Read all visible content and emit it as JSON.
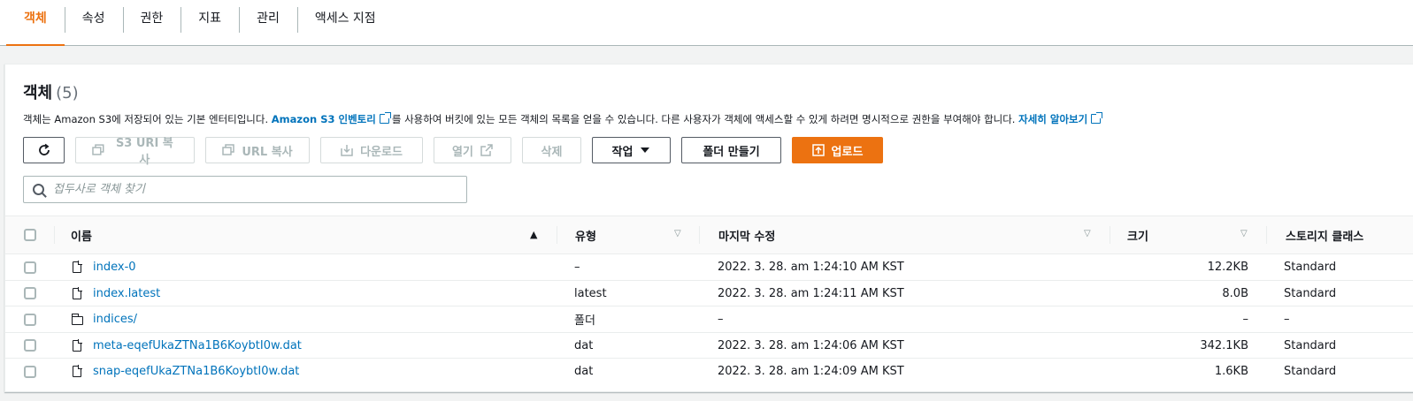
{
  "tabs": [
    {
      "label": "객체"
    },
    {
      "label": "속성"
    },
    {
      "label": "권한"
    },
    {
      "label": "지표"
    },
    {
      "label": "관리"
    },
    {
      "label": "액세스 지점"
    }
  ],
  "header": {
    "title": "객체",
    "count": "(5)",
    "description_pre": "객체는 Amazon S3에 저장되어 있는 기본 엔터티입니다.",
    "inventory_link": "Amazon S3 인벤토리",
    "description_mid": "를 사용하여 버킷에 있는 모든 객체의 목록을 얻을 수 있습니다. 다른 사용자가 객체에 액세스할 수 있게 하려면 명시적으로 권한을 부여해야 합니다.",
    "learn_more_link": "자세히 알아보기"
  },
  "toolbar": {
    "copy_s3_uri": "S3 URI 복사",
    "copy_url": "URL 복사",
    "download": "다운로드",
    "open": "열기",
    "delete": "삭제",
    "actions": "작업",
    "create_folder": "폴더 만들기",
    "upload": "업로드"
  },
  "search": {
    "placeholder": "접두사로 객체 찾기",
    "value": ""
  },
  "table": {
    "columns": {
      "name": "이름",
      "type": "유형",
      "last_modified": "마지막 수정",
      "size": "크기",
      "storage_class": "스토리지 클래스"
    },
    "rows": [
      {
        "icon": "file-icon",
        "name": "index-0",
        "type": "–",
        "last_modified": "2022. 3. 28. am 1:24:10 AM KST",
        "size": "12.2KB",
        "storage_class": "Standard"
      },
      {
        "icon": "file-icon",
        "name": "index.latest",
        "type": "latest",
        "last_modified": "2022. 3. 28. am 1:24:11 AM KST",
        "size": "8.0B",
        "storage_class": "Standard"
      },
      {
        "icon": "folder-icon",
        "name": "indices/",
        "type": "폴더",
        "last_modified": "–",
        "size": "–",
        "storage_class": "–"
      },
      {
        "icon": "file-icon",
        "name": "meta-eqefUkaZTNa1B6KoybtI0w.dat",
        "type": "dat",
        "last_modified": "2022. 3. 28. am 1:24:06 AM KST",
        "size": "342.1KB",
        "storage_class": "Standard"
      },
      {
        "icon": "file-icon",
        "name": "snap-eqefUkaZTNa1B6KoybtI0w.dat",
        "type": "dat",
        "last_modified": "2022. 3. 28. am 1:24:09 AM KST",
        "size": "1.6KB",
        "storage_class": "Standard"
      }
    ]
  },
  "colors": {
    "accent": "#ec7211",
    "link": "#0073bb"
  }
}
